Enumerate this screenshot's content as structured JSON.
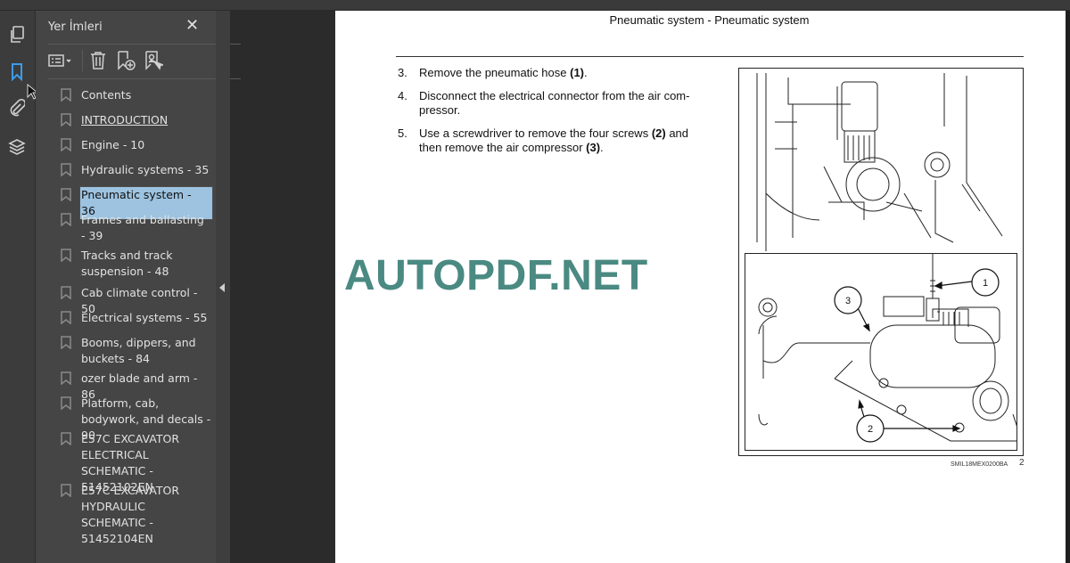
{
  "sidebar_icons": [
    {
      "name": "pages-icon"
    },
    {
      "name": "bookmarks-icon",
      "active": true,
      "color": "#3d9be9"
    },
    {
      "name": "attachments-icon"
    },
    {
      "name": "layers-icon"
    }
  ],
  "bookmarks_panel": {
    "title": "Yer İmleri",
    "close_label": "✕",
    "toolbar": [
      "options-icon",
      "delete-bookmark-icon",
      "add-bookmark-icon",
      "find-bookmark-icon"
    ],
    "items": [
      {
        "label": "Contents"
      },
      {
        "label": "INTRODUCTION",
        "underlined": true
      },
      {
        "label": "Engine - 10"
      },
      {
        "label": "Hydraulic systems - 35"
      },
      {
        "label": "Pneumatic system - 36",
        "selected": true
      },
      {
        "label": "Frames and ballasting - 39"
      },
      {
        "label": "Tracks and track suspension - 48"
      },
      {
        "label": "Cab climate control - 50"
      },
      {
        "label": "Electrical systems - 55"
      },
      {
        "label": "Booms, dippers, and buckets - 84"
      },
      {
        "label": "ozer blade and arm - 86"
      },
      {
        "label": "Platform, cab, bodywork, and decals - 90"
      },
      {
        "label": "E57C EXCAVATOR ELECTRICAL SCHEMATIC - 51452102EN"
      },
      {
        "label": "E57C EXCAVATOR HYDRAULIC SCHEMATIC - 51452104EN"
      }
    ]
  },
  "document": {
    "header": "Pneumatic system - Pneumatic system",
    "steps": [
      {
        "num": "3.",
        "pre": "Remove the pneumatic hose ",
        "b1": "(1)",
        "mid": ".",
        "b2": "",
        "post": ""
      },
      {
        "num": "4.",
        "pre": "Disconnect the electrical connector from the air com-pressor.",
        "b1": "",
        "mid": "",
        "b2": "",
        "post": ""
      },
      {
        "num": "5.",
        "pre": "Use a screwdriver to remove the four screws ",
        "b1": "(2)",
        "mid": " and then remove the air compressor ",
        "b2": "(3)",
        "post": "."
      }
    ],
    "callouts": [
      "1",
      "2",
      "3"
    ],
    "figure_caption": "SMIL18MEX0200BA",
    "figure_number": "2",
    "watermark": "AUTOPDF.NET",
    "watermark_color": "#4a8a82"
  }
}
